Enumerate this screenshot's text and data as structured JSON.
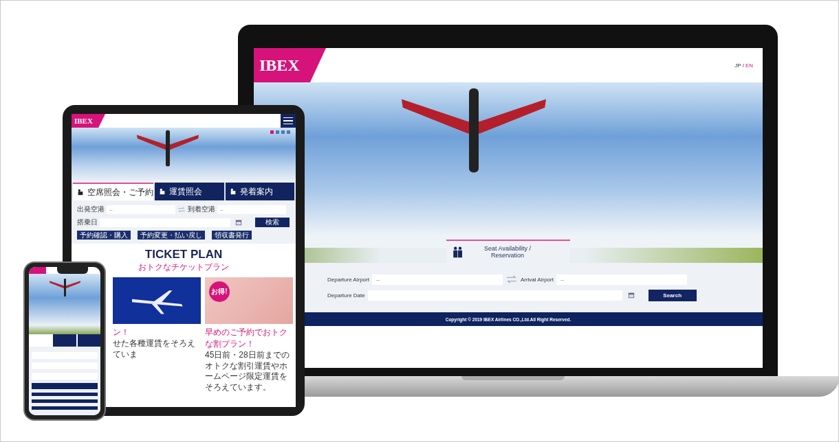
{
  "laptop": {
    "logo": "IBEX",
    "languages": [
      {
        "label": "JP",
        "selected": false
      },
      {
        "label": "EN",
        "selected": true
      }
    ],
    "language_separator": "/",
    "tab": {
      "label": "Seat Availability / Reservation"
    },
    "form": {
      "departure_label": "Departure Airport",
      "departure_placeholder": "--",
      "arrival_label": "Arrival Airport",
      "arrival_placeholder": "--",
      "date_label": "Departure Date",
      "search_button": "Search"
    },
    "footer": "Copyright © 2019 IBEX Airlines CO.,Ltd.All Right Reserved."
  },
  "tablet": {
    "logo": "IBEX",
    "carousel_dots": [
      {
        "selected": true
      },
      {
        "selected": false
      },
      {
        "selected": false
      },
      {
        "selected": false
      }
    ],
    "tabs": [
      {
        "label": "空席照会・ご予約",
        "selected": true
      },
      {
        "label": "運賃照会",
        "selected": false
      },
      {
        "label": "発着案内",
        "selected": false
      }
    ],
    "form": {
      "departure_label": "出発空港",
      "departure_placeholder": "--",
      "arrival_label": "到着空港",
      "arrival_placeholder": "--",
      "date_label": "搭乗日",
      "search_button": "検索"
    },
    "links": [
      "予約確認・購入",
      "予約変更・払い戻し",
      "領収書発行"
    ],
    "ticket_plan": {
      "title": "TICKET PLAN",
      "subtitle": "おトクなチケットプラン",
      "cards": [
        {
          "kind": "plane",
          "caption": "ン！",
          "text": "せた各種運賃をそろえていま"
        },
        {
          "kind": "keyboard",
          "badge": "お得!",
          "caption": "早めのご予約でおトクな割プラン！",
          "text": "45日前・28日前までのオトクな割引運賃やホームページ限定運賃をそろえています。"
        }
      ]
    }
  }
}
